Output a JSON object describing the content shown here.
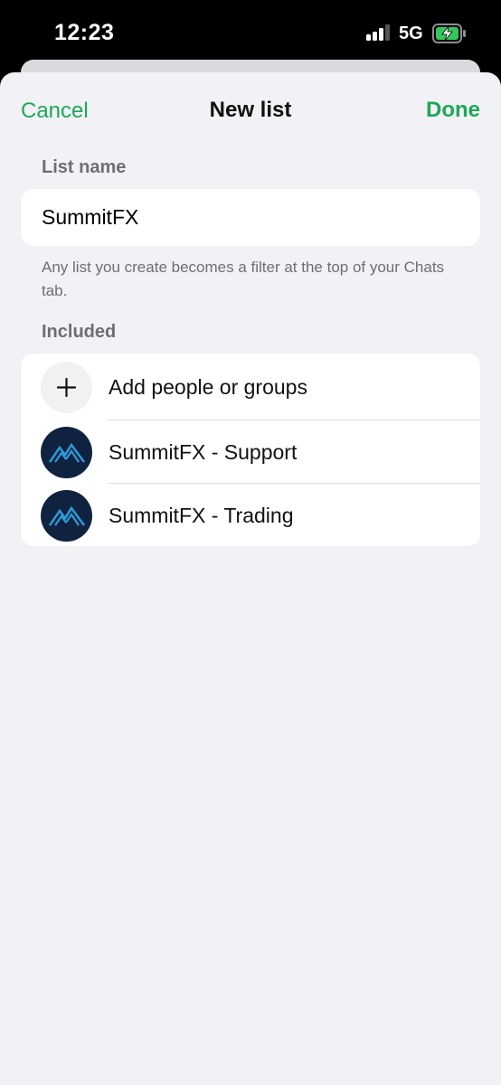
{
  "status": {
    "time": "12:23",
    "network": "5G",
    "signal_bars_active": 3,
    "battery_state": "charging"
  },
  "nav": {
    "cancel_label": "Cancel",
    "title": "New list",
    "done_label": "Done"
  },
  "list_name": {
    "section_label": "List name",
    "value": "SummitFX",
    "hint": "Any list you create becomes a filter at the top of your Chats tab."
  },
  "included": {
    "section_label": "Included",
    "add_label": "Add people or groups",
    "items": [
      {
        "label": "SummitFX - Support",
        "icon": "summitfx-logo-icon"
      },
      {
        "label": "SummitFX - Trading",
        "icon": "summitfx-logo-icon"
      }
    ]
  },
  "colors": {
    "accent": "#1fa855",
    "background": "#f1f1f6",
    "avatar_bg": "#0f2341",
    "logo_blue": "#2e9ad6"
  }
}
